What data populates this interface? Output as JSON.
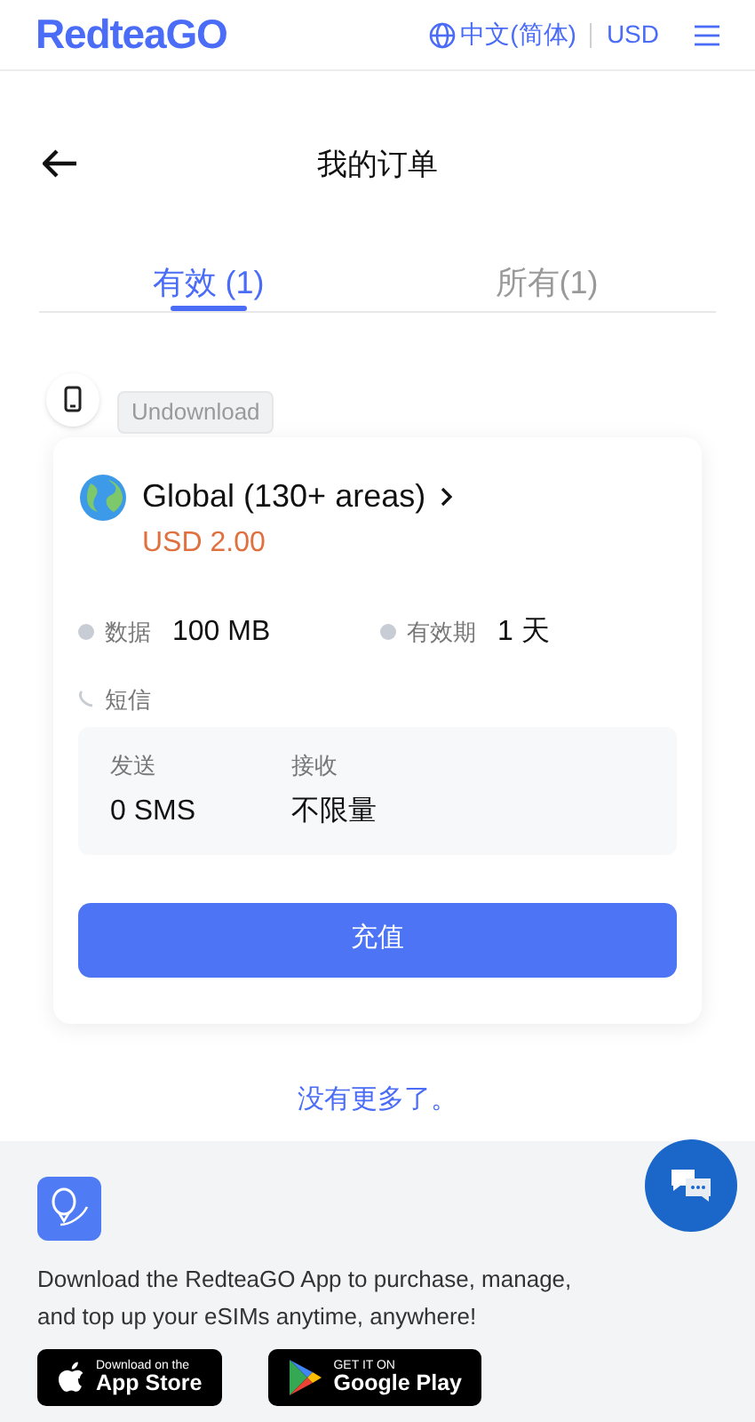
{
  "header": {
    "logo": "RedteaGO",
    "language": "中文(简体)",
    "currency": "USD"
  },
  "page_title": "我的订单",
  "tabs": [
    {
      "label": "有效 (1)",
      "selected": true
    },
    {
      "label": "所有(1)",
      "selected": false
    }
  ],
  "order": {
    "status": "Undownload",
    "name": "Global (130+ areas)",
    "price": "USD 2.00",
    "specs": [
      {
        "label": "数据",
        "value": "100 MB"
      },
      {
        "label": "有效期",
        "value": "1 天"
      }
    ],
    "sms": {
      "label": "短信",
      "send_label": "发送",
      "send_value": "0 SMS",
      "receive_label": "接收",
      "receive_value": "不限量"
    },
    "button": "充值"
  },
  "end_note": "没有更多了。",
  "footer": {
    "text": "Download the RedteaGO App to purchase, manage, and top up your eSIMs anytime, anywhere!",
    "badges": [
      {
        "kind": "apple",
        "small": "Download on the",
        "big": "App Store"
      },
      {
        "kind": "google",
        "small": "GET IT ON",
        "big": "Google Play"
      }
    ]
  }
}
